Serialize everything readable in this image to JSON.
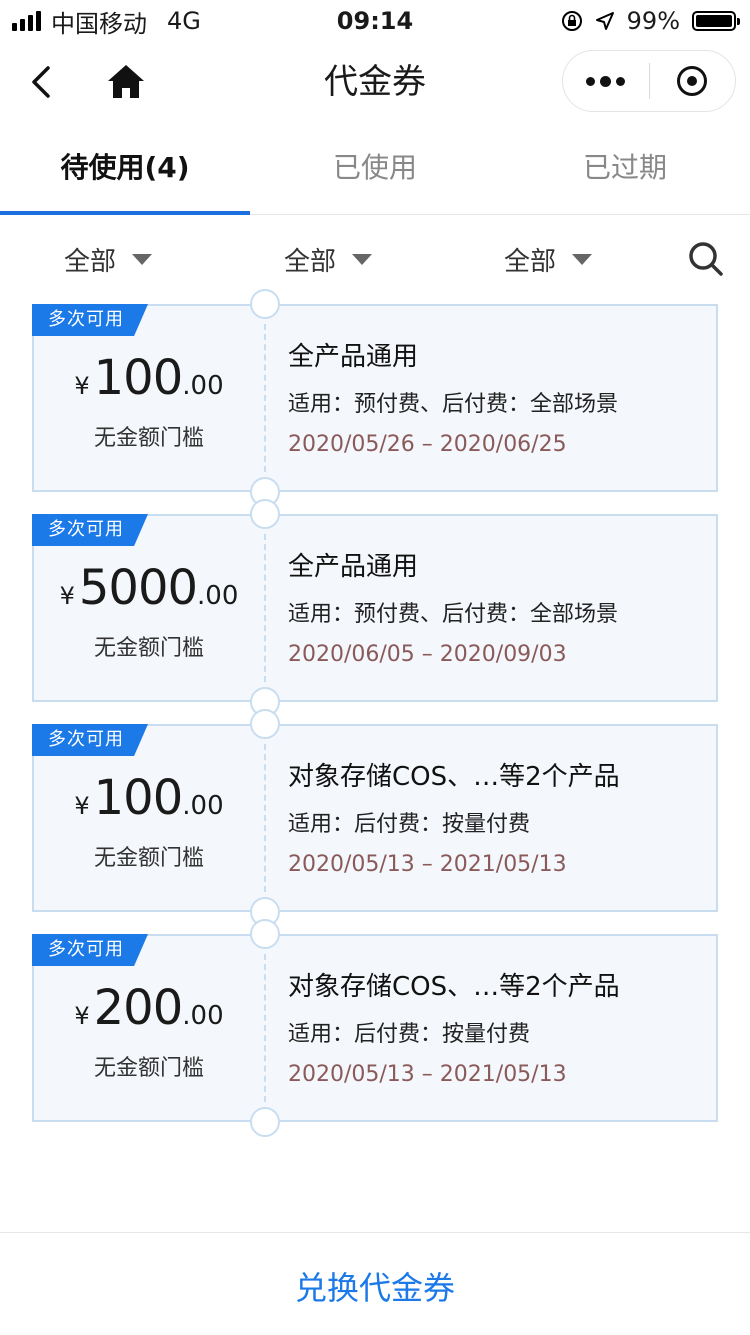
{
  "status_bar": {
    "carrier": "中国移动",
    "network": "4G",
    "time": "09:14",
    "battery": "99%",
    "battery_level": 0.99
  },
  "nav": {
    "title": "代金券",
    "icons": [
      "back-icon",
      "home-icon",
      "more-icon",
      "target-icon"
    ]
  },
  "tabs": [
    {
      "label": "待使用(4)",
      "active": true
    },
    {
      "label": "已使用",
      "active": false
    },
    {
      "label": "已过期",
      "active": false
    }
  ],
  "filters": [
    {
      "label": "全部"
    },
    {
      "label": "全部"
    },
    {
      "label": "全部"
    }
  ],
  "coupons": [
    {
      "badge": "多次可用",
      "currency": "¥",
      "amount": "100",
      "decimal": ".00",
      "threshold": "无金额门槛",
      "title": "全产品通用",
      "scope": "适用：预付费、后付费：全部场景",
      "dates": "2020/05/26 – 2020/06/25"
    },
    {
      "badge": "多次可用",
      "currency": "¥",
      "amount": "5000",
      "decimal": ".00",
      "threshold": "无金额门槛",
      "title": "全产品通用",
      "scope": "适用：预付费、后付费：全部场景",
      "dates": "2020/06/05 – 2020/09/03"
    },
    {
      "badge": "多次可用",
      "currency": "¥",
      "amount": "100",
      "decimal": ".00",
      "threshold": "无金额门槛",
      "title": "对象存储COS、…等2个产品",
      "scope": "适用：后付费：按量付费",
      "dates": "2020/05/13 – 2021/05/13"
    },
    {
      "badge": "多次可用",
      "currency": "¥",
      "amount": "200",
      "decimal": ".00",
      "threshold": "无金额门槛",
      "title": "对象存储COS、…等2个产品",
      "scope": "适用：后付费：按量付费",
      "dates": "2020/05/13 – 2021/05/13"
    }
  ],
  "bottom": {
    "exchange_label": "兑换代金券"
  },
  "colors": {
    "accent": "#1b79e8",
    "date_text": "#8a5a5a",
    "coupon_bg": "#f4f7fb",
    "coupon_border": "#c9ddf0"
  }
}
